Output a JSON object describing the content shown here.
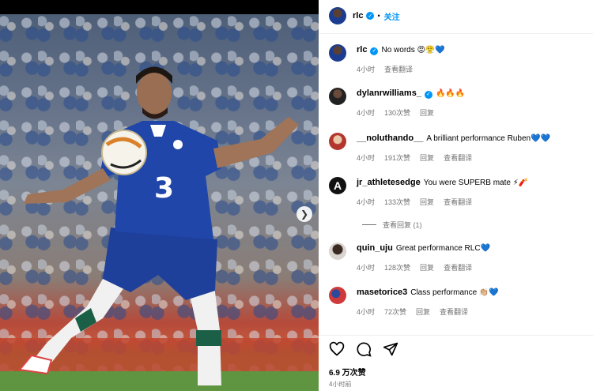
{
  "post": {
    "username": "rlc",
    "follow_label": "关注",
    "dot": "•"
  },
  "comments": [
    {
      "user": "rlc",
      "text": "No words 😡😤💙",
      "time": "4小时",
      "likes": "",
      "reply": "",
      "translate": "查看翻译"
    },
    {
      "user": "dylanrwilliams_",
      "text": "🔥🔥🔥",
      "time": "4小时",
      "likes": "130次赞",
      "reply": "回复",
      "translate": ""
    },
    {
      "user": "__noluthando__",
      "text": "A brilliant performance Ruben💙💙",
      "time": "4小时",
      "likes": "191次赞",
      "reply": "回复",
      "translate": "查看翻译"
    },
    {
      "user": "jr_athletesedge",
      "text": "You were SUPERB mate ⚡🧨",
      "time": "4小时",
      "likes": "133次赞",
      "reply": "回复",
      "translate": "查看翻译"
    },
    {
      "user": "quin_uju",
      "text": "Great performance RLC💙",
      "time": "4小时",
      "likes": "128次赞",
      "reply": "回复",
      "translate": "查看翻译"
    },
    {
      "user": "masetorice3",
      "text": "Class performance 👏🏼💙",
      "time": "4小时",
      "likes": "72次赞",
      "reply": "回复",
      "translate": "查看翻译"
    }
  ],
  "view_replies": "查看回复 (1)",
  "footer": {
    "likes": "6.9 万次赞",
    "time": "4小时前"
  }
}
